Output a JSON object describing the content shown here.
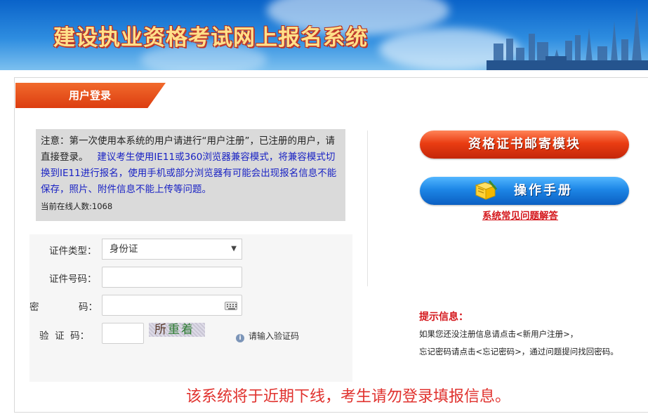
{
  "header": {
    "title": "建设执业资格考试网上报名系统"
  },
  "login_tab": {
    "label": "用户登录"
  },
  "notice": {
    "text_main": "注意：第一次使用本系统的用户请进行“用户注册”，已注册的用户，请直接登录。",
    "text_blue": "建议考生使用IE11或360浏览器兼容模式，将兼容模式切换到IE11进行报名，使用手机或部分浏览器有可能会出现报名信息不能保存，照片、附件信息不能上传等问题。",
    "online_count": "当前在线人数:1068"
  },
  "form": {
    "id_type_label": "证件类型：",
    "id_type_value": "身份证",
    "id_number_label": "证件号码：",
    "id_number_value": "",
    "password_label_1": "密",
    "password_label_2": "码：",
    "password_value": "",
    "captcha_label": "验  证  码：",
    "captcha_value": "",
    "captcha_image_text_1": "所",
    "captcha_image_text_2": "重着",
    "captcha_hint": "请输入验证码"
  },
  "actions": {
    "cert_mail_button": "资格证书邮寄模块",
    "manual_button": "操作手册",
    "faq_link": "系统常见问题解答"
  },
  "tips": {
    "title": "提示信息：",
    "line1": "如果您还没注册信息请点击<新用户注册>，",
    "line2": "忘记密码请点击<忘记密码>，通过问题提问找回密码。"
  },
  "footer": {
    "message": "该系统将于近期下线，考生请勿登录填报信息。"
  },
  "colors": {
    "accent_red": "#d4161b",
    "banner_blue": "#2e8de0",
    "button_red": "#ea3d12",
    "button_blue": "#1d86e6"
  },
  "icons": {
    "select_arrow": "chevron-down-icon",
    "password_keyboard": "keyboard-icon",
    "hint": "info-icon",
    "manual": "book-icon"
  }
}
